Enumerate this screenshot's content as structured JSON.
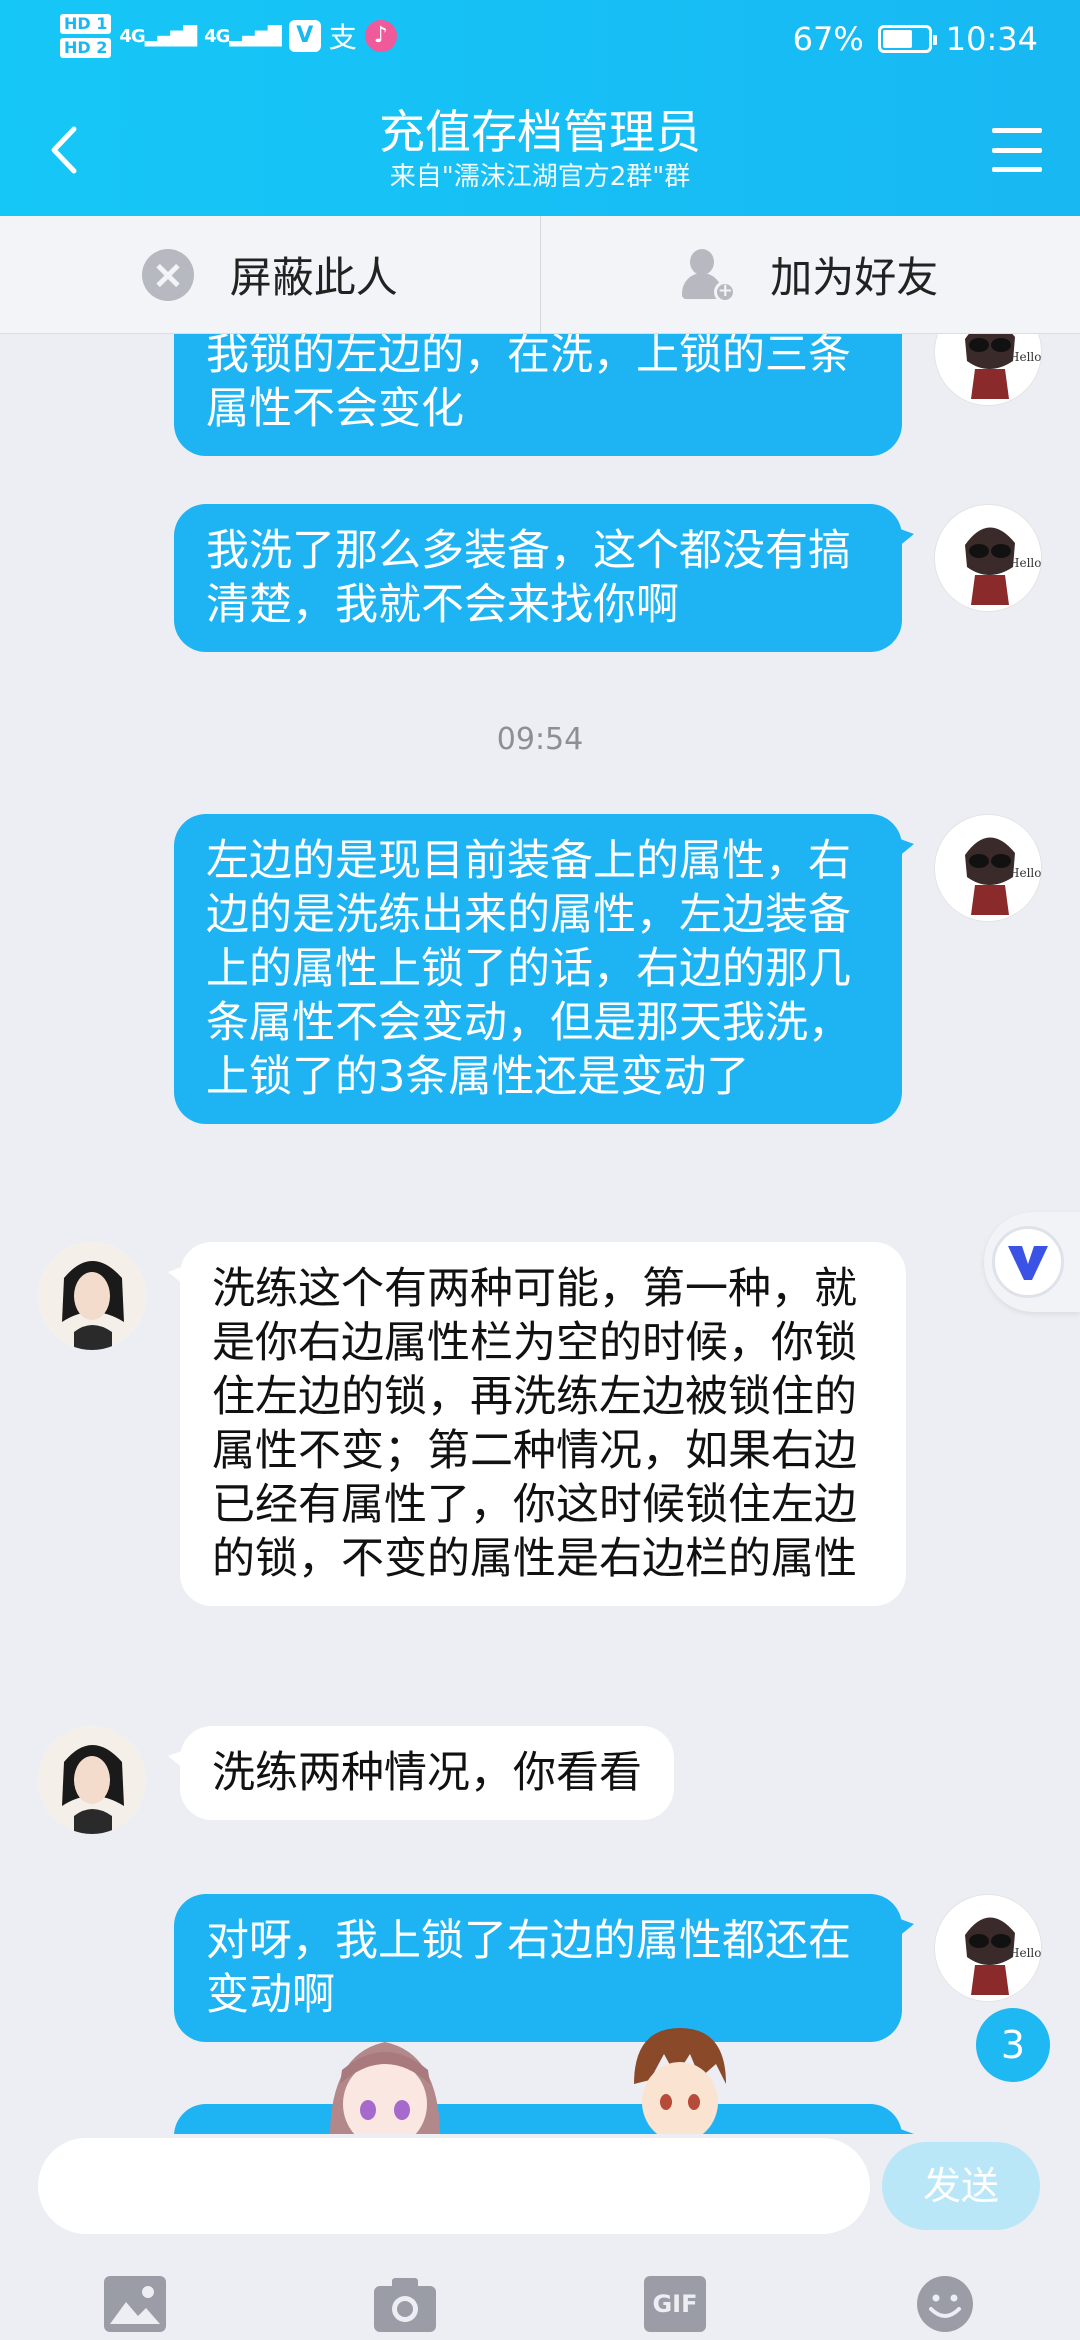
{
  "status_bar": {
    "hd1": "HD 1",
    "hd2": "HD 2",
    "sig1": "4G",
    "sig2": "4G",
    "app1": "V",
    "app2": "支",
    "app3": "♪",
    "battery": "67%",
    "time": "10:34"
  },
  "header": {
    "title": "充值存档管理员",
    "subtitle": "来自\"濡沫江湖官方2群\"群"
  },
  "action_bar": {
    "block_label": "屏蔽此人",
    "add_friend_label": "加为好友"
  },
  "messages": [
    {
      "side": "out",
      "text": "我锁的左边的，在洗，上锁的三条属性不会变化"
    },
    {
      "side": "out",
      "text": "我洗了那么多装备，这个都没有搞清楚，我就不会来找你啊"
    },
    {
      "side": "out",
      "text": "左边的是现目前装备上的属性，右边的是洗练出来的属性，左边装备上的属性上锁了的话，右边的那几条属性不会变动，但是那天我洗，上锁了的3条属性还是变动了"
    },
    {
      "side": "in",
      "text": "洗练这个有两种可能，第一种，就是你右边属性栏为空的时候，你锁住左边的锁，再洗练左边被锁住的属性不变；第二种情况，如果右边已经有属性了，你这时候锁住左边的锁，不变的属性是右边栏的属性"
    },
    {
      "side": "in",
      "text": "洗练两种情况，你看看"
    },
    {
      "side": "out",
      "text": "对呀，我上锁了右边的属性都还在变动啊"
    }
  ],
  "timestamp": "09:54",
  "unread_count": "3",
  "input": {
    "placeholder": "",
    "send_label": "发送"
  },
  "toolbar": {
    "gif_label": "GIF"
  },
  "colors": {
    "header": "#18b8f3",
    "bubble_out": "#1eb4f3",
    "bubble_in": "#ffffff",
    "background": "#eceef3"
  }
}
